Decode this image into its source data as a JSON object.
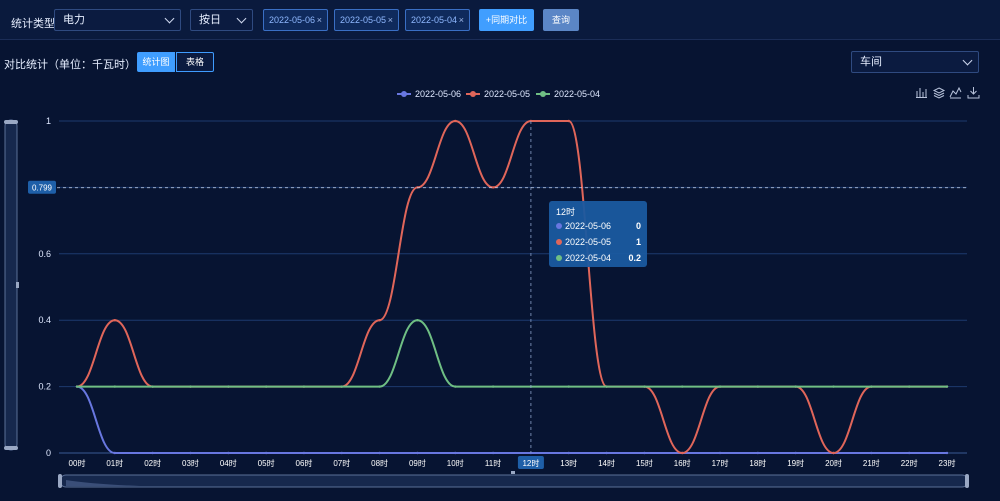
{
  "toolbar": {
    "stat_type_label": "统计类型",
    "energy_select": "电力",
    "period_select": "按日",
    "date_tags": [
      "2022-05-06",
      "2022-05-05",
      "2022-05-04"
    ],
    "compare_button": "+同期对比",
    "query_button": "查询"
  },
  "header": {
    "title": "对比统计（单位：千瓦时）",
    "view_tabs": [
      "统计图",
      "表格"
    ],
    "active_tab": "统计图",
    "scope_select": "车间"
  },
  "colors": {
    "accent": "#409eff",
    "series": [
      "#6877e0",
      "#e0665a",
      "#6fbf84"
    ]
  },
  "toolbox_icons": [
    "bar-chart-icon",
    "stack-icon",
    "line-chart-icon",
    "download-icon"
  ],
  "chart_data": {
    "type": "line",
    "smooth": true,
    "x": [
      "00时",
      "01时",
      "02时",
      "03时",
      "04时",
      "05时",
      "06时",
      "07时",
      "08时",
      "09时",
      "10时",
      "11时",
      "12时",
      "13时",
      "14时",
      "15时",
      "16时",
      "17时",
      "18时",
      "19时",
      "20时",
      "21时",
      "22时",
      "23时"
    ],
    "series": [
      {
        "name": "2022-05-06",
        "values": [
          0.2,
          0,
          0,
          0,
          0,
          0,
          0,
          0,
          0,
          0,
          0,
          0,
          0,
          0,
          0,
          0,
          0,
          0,
          0,
          0,
          0,
          0,
          0,
          0
        ]
      },
      {
        "name": "2022-05-05",
        "values": [
          0.2,
          0.4,
          0.2,
          0.2,
          0.2,
          0.2,
          0.2,
          0.2,
          0.4,
          0.8,
          1,
          0.8,
          1,
          1,
          0.2,
          0.2,
          0,
          0.2,
          0.2,
          0.2,
          0,
          0.2,
          0.2,
          0.2
        ]
      },
      {
        "name": "2022-05-04",
        "values": [
          0.2,
          0.2,
          0.2,
          0.2,
          0.2,
          0.2,
          0.2,
          0.2,
          0.2,
          0.4,
          0.2,
          0.2,
          0.2,
          0.2,
          0.2,
          0.2,
          0.2,
          0.2,
          0.2,
          0.2,
          0.2,
          0.2,
          0.2,
          0.2
        ]
      }
    ],
    "yticks": [
      "0",
      "0.2",
      "0.4",
      "0.6",
      "0.8",
      "1"
    ],
    "ylim": [
      0,
      1
    ],
    "grid": true,
    "legend": "top-center",
    "axis_pointer": {
      "x": "12时",
      "y_label": "0.799"
    },
    "tooltip": {
      "title": "12时",
      "rows": [
        {
          "name": "2022-05-06",
          "value": "0"
        },
        {
          "name": "2022-05-05",
          "value": "1"
        },
        {
          "name": "2022-05-04",
          "value": "0.2"
        }
      ]
    }
  }
}
